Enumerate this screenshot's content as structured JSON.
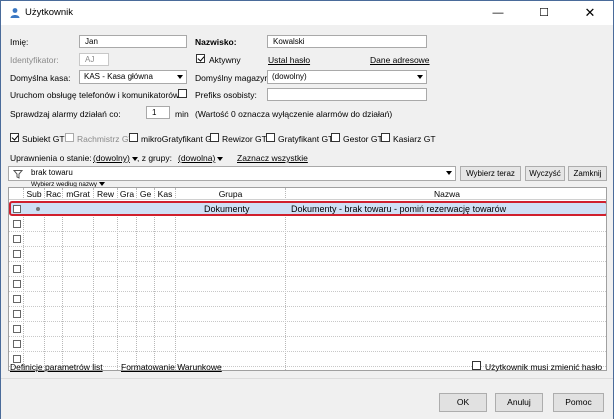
{
  "window": {
    "title": "Użytkownik"
  },
  "form": {
    "imie_label": "Imię:",
    "imie_value": "Jan",
    "nazwisko_label": "Nazwisko:",
    "nazwisko_value": "Kowalski",
    "identyfikator_label": "Identyfikator:",
    "identyfikator_value": "AJ",
    "aktywny_label": "Aktywny",
    "ustal_haslo": "Ustal hasło",
    "dane_adresowe": "Dane adresowe",
    "kasa_label": "Domyślna kasa:",
    "kasa_value": "KAS - Kasa główna",
    "magazyn_label": "Domyślny magazyn:",
    "magazyn_value": "(dowolny)",
    "telefon_label": "Uruchom obsługę telefonów i komunikatorów",
    "prefiks_label": "Prefiks osobisty:",
    "alarmy_label": "Sprawdzaj alarmy działań co:",
    "alarmy_value": "1",
    "alarmy_unit": "min",
    "alarmy_hint": "(Wartość 0 oznacza wyłączenie alarmów do działań)"
  },
  "modules": [
    {
      "label": "Subiekt GT",
      "checked": true,
      "disabled": false
    },
    {
      "label": "Rachmistrz GT",
      "checked": false,
      "disabled": true
    },
    {
      "label": "mikroGratyfikant GT",
      "checked": false,
      "disabled": false
    },
    {
      "label": "Rewizor GT",
      "checked": false,
      "disabled": false
    },
    {
      "label": "Gratyfikant GT",
      "checked": false,
      "disabled": false
    },
    {
      "label": "Gestor GT",
      "checked": false,
      "disabled": false
    },
    {
      "label": "Kasiarz GT",
      "checked": false,
      "disabled": false
    }
  ],
  "filters": {
    "uprawnienia_label": "Uprawnienia o stanie:",
    "stan_value": "(dowolny)",
    "grupa_label": ", z grupy:",
    "grupa_value": "(dowolna)",
    "zaznacz": "Zaznacz wszystkie",
    "search_value": "brak towaru",
    "wybierz_wg": "Wybierz według nazwy",
    "btn_wybierz": "Wybierz teraz",
    "btn_wyczysc": "Wyczyść",
    "btn_zamknij": "Zamknij"
  },
  "grid": {
    "columns": [
      "Sub",
      "Rac",
      "mGrat",
      "Rew",
      "Gra",
      "Ge",
      "Kas",
      "Grupa",
      "Nazwa"
    ],
    "rows": [
      {
        "grupa": "Dokumenty",
        "nazwa": "Dokumenty - brak towaru - pomiń rezerwację towarów"
      }
    ]
  },
  "bottom": {
    "definicje": "Definicje parametrów list",
    "formatowanie": "Formatowanie Warunkowe",
    "zmien_haslo": "Użytkownik musi zmienić hasło"
  },
  "footer": {
    "ok": "OK",
    "anuluj": "Anuluj",
    "pomoc": "Pomoc"
  }
}
